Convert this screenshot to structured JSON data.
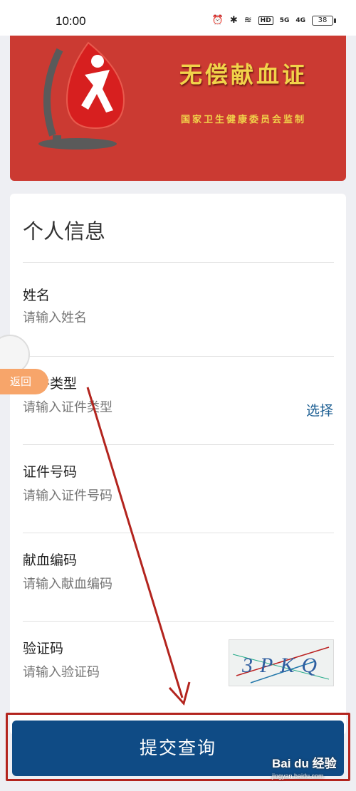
{
  "status_bar": {
    "time": "10:00",
    "battery": "38",
    "hd": "HD",
    "signal_1": "5G",
    "signal_2": "4G"
  },
  "banner": {
    "title": "无偿献血证",
    "subtitle": "国家卫生健康委员会监制",
    "background_color": "#cb3a32",
    "text_color": "#f1d34a"
  },
  "form": {
    "section_title": "个人信息",
    "fields": [
      {
        "label": "姓名",
        "placeholder": "请输入姓名"
      },
      {
        "label": "证件类型",
        "placeholder": "请输入证件类型",
        "action": "选择"
      },
      {
        "label": "证件号码",
        "placeholder": "请输入证件号码"
      },
      {
        "label": "献血编码",
        "placeholder": "请输入献血编码"
      },
      {
        "label": "验证码",
        "placeholder": "请输入验证码"
      }
    ],
    "captcha_text": "3PKQ"
  },
  "floating": {
    "back_label": "返回"
  },
  "submit": {
    "label": "提交查询",
    "color": "#0f4b85"
  },
  "watermark": {
    "brand": "Bai du 经验",
    "url": "jingyan.baidu.com"
  }
}
